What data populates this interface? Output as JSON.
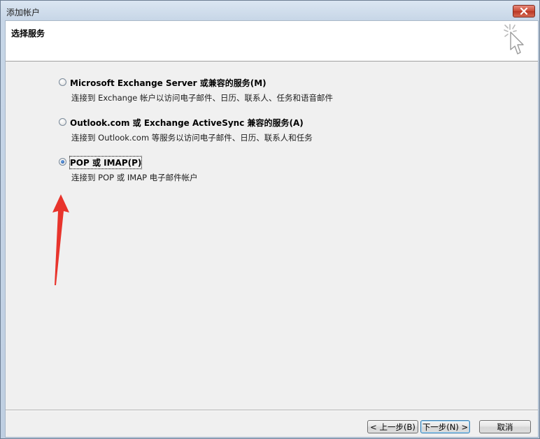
{
  "window": {
    "title": "添加帐户"
  },
  "header": {
    "title": "选择服务"
  },
  "options": [
    {
      "label": "Microsoft Exchange Server 或兼容的服务(M)",
      "description": "连接到 Exchange 帐户以访问电子邮件、日历、联系人、任务和语音邮件",
      "checked": false
    },
    {
      "label": "Outlook.com 或 Exchange ActiveSync 兼容的服务(A)",
      "description": "连接到 Outlook.com 等服务以访问电子邮件、日历、联系人和任务",
      "checked": false
    },
    {
      "label": "POP 或 IMAP(P)",
      "description": "连接到 POP 或 IMAP 电子邮件帐户",
      "checked": true
    }
  ],
  "buttons": {
    "back": "< 上一步(B)",
    "next": "下一步(N) >",
    "cancel": "取消"
  },
  "colors": {
    "annotation_arrow": "#e8342c",
    "close_button": "#c84a35"
  }
}
